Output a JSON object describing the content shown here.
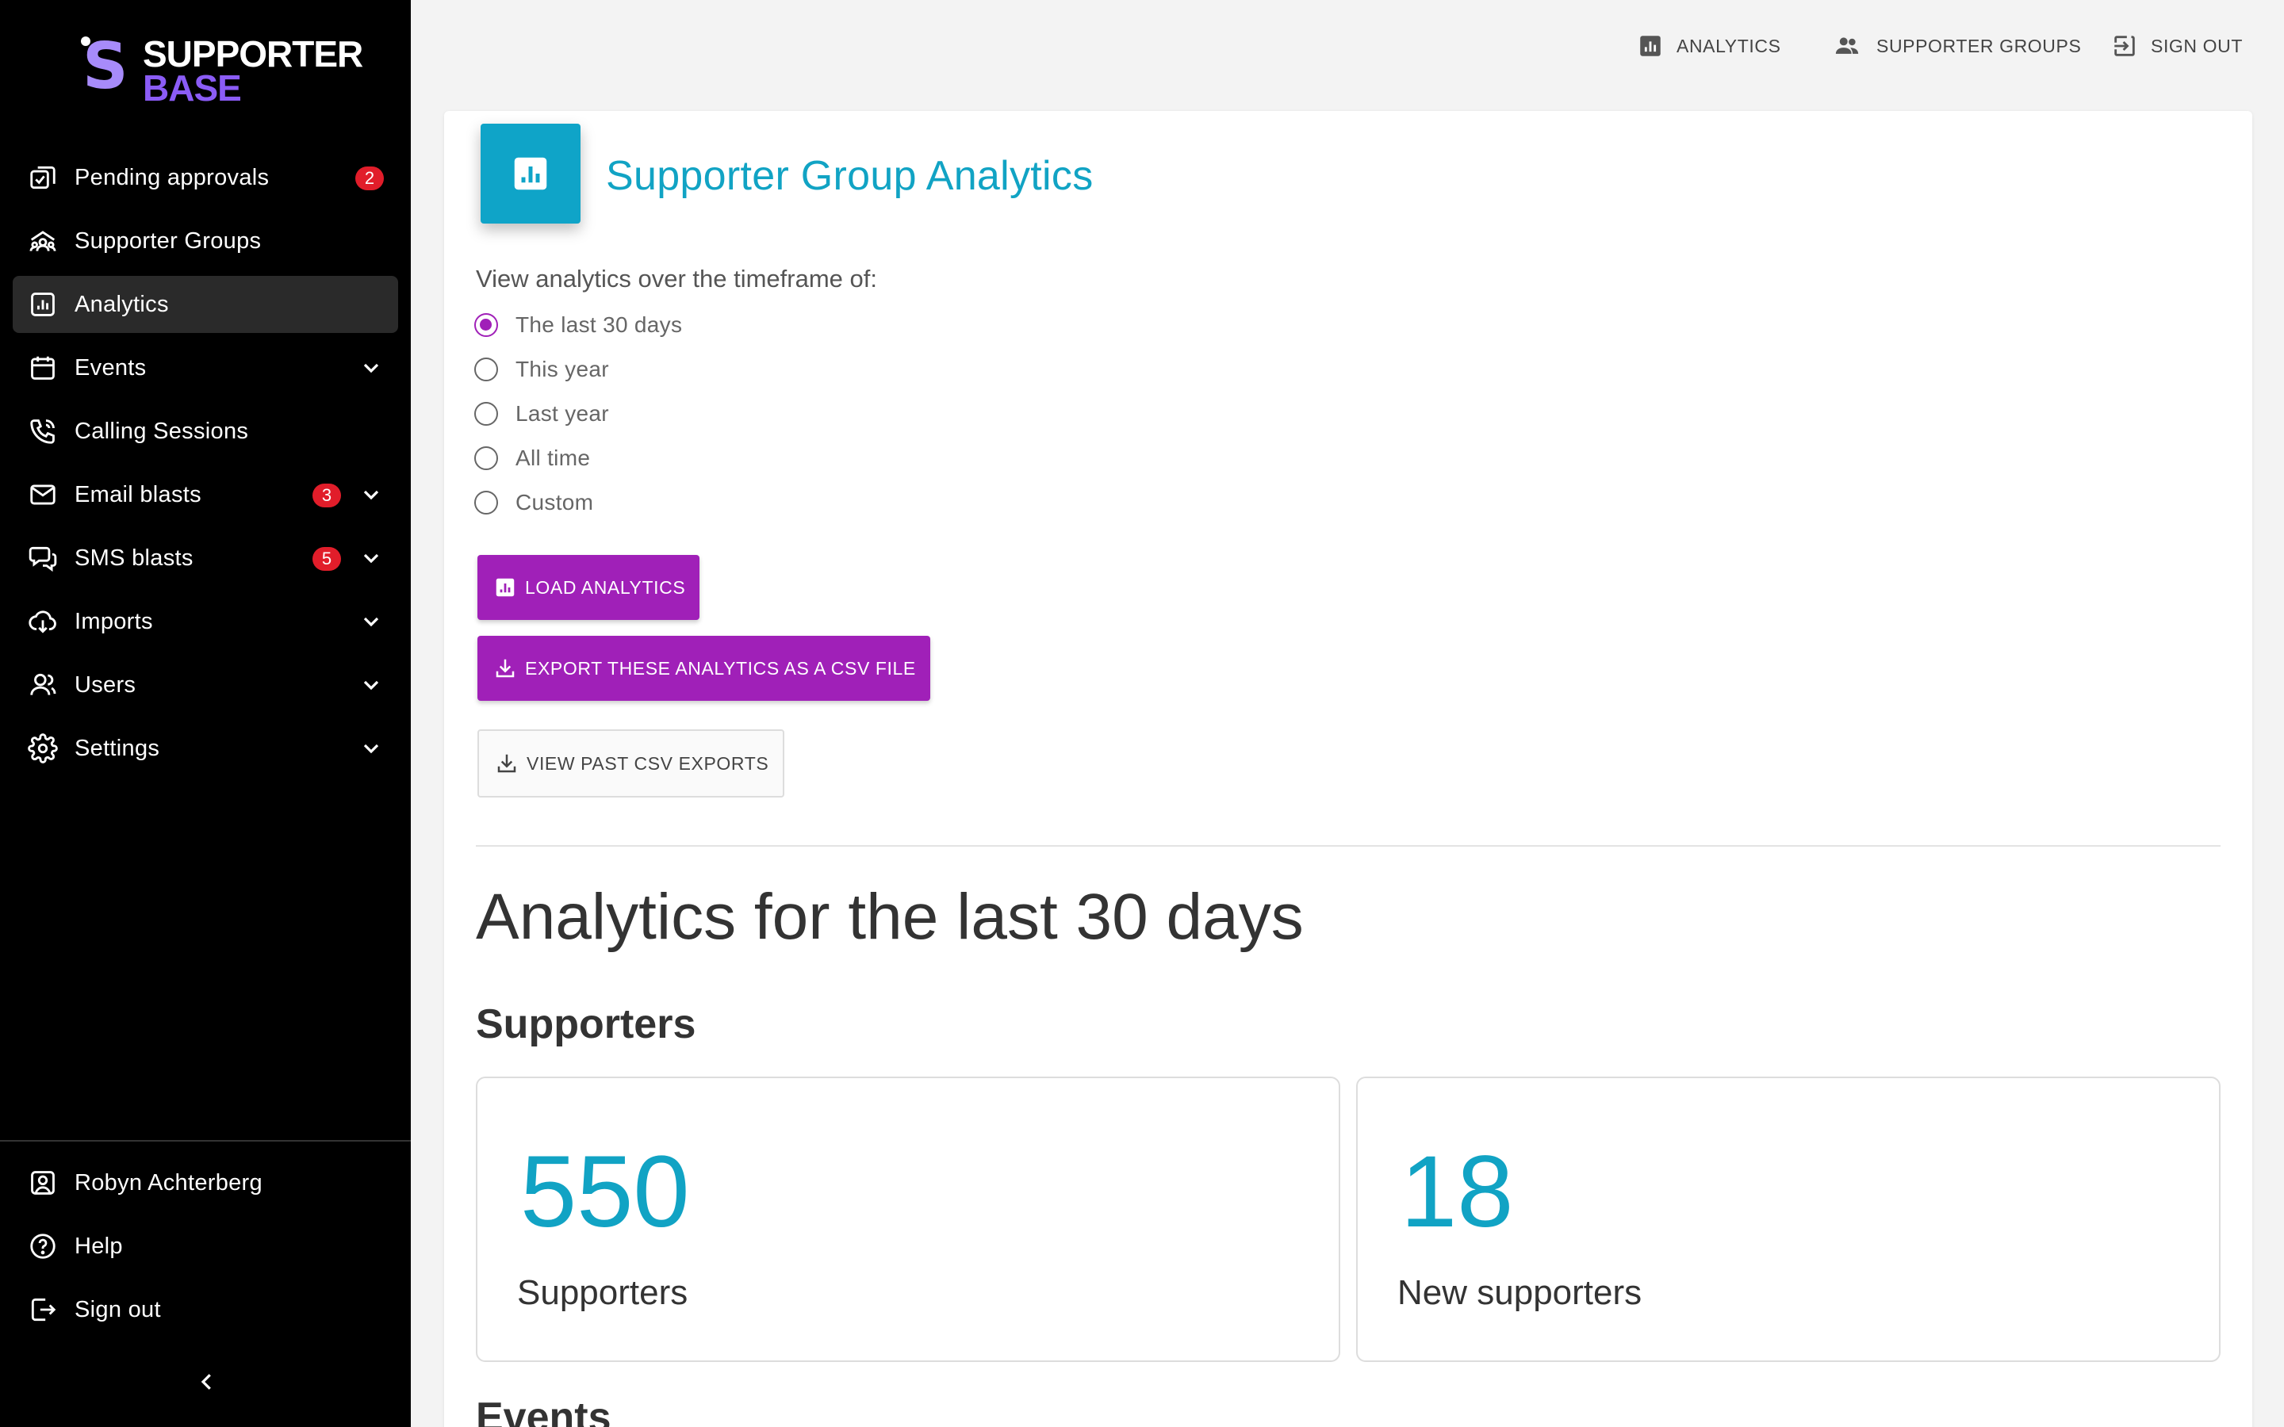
{
  "brand": {
    "line1": "SUPPORTER",
    "line2": "BASE"
  },
  "sidebar": {
    "items": [
      {
        "label": "Pending approvals",
        "badge": "2",
        "icon": "approvals-icon"
      },
      {
        "label": "Supporter Groups",
        "icon": "groups-icon"
      },
      {
        "label": "Analytics",
        "icon": "analytics-icon",
        "active": true
      },
      {
        "label": "Events",
        "icon": "calendar-icon"
      },
      {
        "label": "Calling Sessions",
        "icon": "phone-icon"
      },
      {
        "label": "Email blasts",
        "badge": "3",
        "icon": "mail-icon"
      },
      {
        "label": "SMS blasts",
        "badge": "5",
        "icon": "sms-icon"
      },
      {
        "label": "Imports",
        "icon": "import-icon"
      },
      {
        "label": "Users",
        "icon": "users-icon"
      },
      {
        "label": "Settings",
        "icon": "gear-icon"
      }
    ],
    "bottom": [
      {
        "label": "Robyn Achterberg",
        "icon": "user-icon"
      },
      {
        "label": "Help",
        "icon": "help-icon"
      },
      {
        "label": "Sign out",
        "icon": "sign-out-icon"
      }
    ]
  },
  "topbar": {
    "analytics": "ANALYTICS",
    "groups": "SUPPORTER GROUPS",
    "signout": "SIGN OUT"
  },
  "main": {
    "title": "Supporter Group Analytics",
    "timeframe_label": "View analytics over the timeframe of:",
    "options": [
      "The last 30 days",
      "This year",
      "Last year",
      "All time",
      "Custom"
    ],
    "selected_option": "The last 30 days",
    "load_button": "LOAD ANALYTICS",
    "export_button": "EXPORT THESE ANALYTICS AS A CSV FILE",
    "past_exports_button": "VIEW PAST CSV EXPORTS",
    "results_heading": "Analytics for the last 30 days",
    "supporters_heading": "Supporters",
    "events_heading": "Events",
    "stats": [
      {
        "value": "550",
        "label": "Supporters"
      },
      {
        "value": "18",
        "label": "New supporters"
      }
    ]
  },
  "colors": {
    "accent_purple": "#a020b8",
    "accent_cyan": "#11a3c4",
    "badge_red": "#e11d2a",
    "sidebar_bg": "#000000"
  }
}
